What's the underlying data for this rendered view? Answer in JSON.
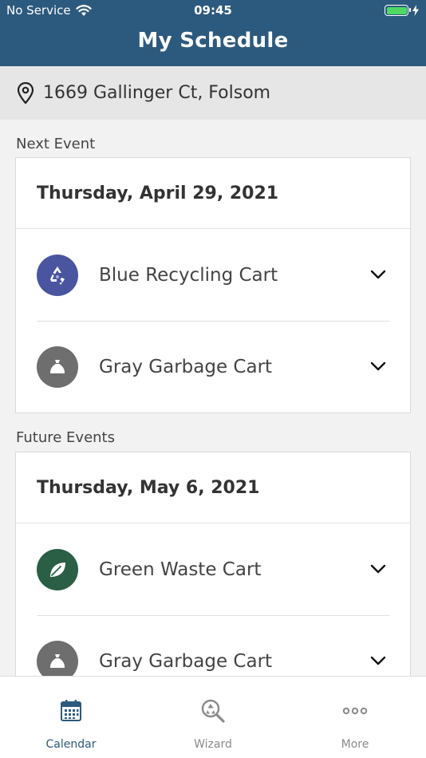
{
  "status": {
    "carrier": "No Service",
    "time": "09:45"
  },
  "header": {
    "title": "My Schedule"
  },
  "address": {
    "text": "1669 Gallinger Ct, Folsom"
  },
  "next_event": {
    "label": "Next Event",
    "date": "Thursday, April 29, 2021",
    "items": [
      {
        "label": "Blue Recycling Cart",
        "icon": "recycle-icon",
        "color": "#4a55a0"
      },
      {
        "label": "Gray Garbage Cart",
        "icon": "garbage-bag-icon",
        "color": "#6e6e6e"
      }
    ]
  },
  "future_events": {
    "label": "Future Events",
    "date": "Thursday, May 6, 2021",
    "items": [
      {
        "label": "Green Waste Cart",
        "icon": "leaf-icon",
        "color": "#2a5e45"
      },
      {
        "label": "Gray Garbage Cart",
        "icon": "garbage-bag-icon",
        "color": "#6e6e6e"
      }
    ]
  },
  "tabs": [
    {
      "label": "Calendar",
      "icon": "calendar-icon",
      "active": true
    },
    {
      "label": "Wizard",
      "icon": "wizard-search-icon",
      "active": false
    },
    {
      "label": "More",
      "icon": "more-dots-icon",
      "active": false
    }
  ],
  "colors": {
    "header": "#2c5a7e",
    "tab_active": "#2c5a7e",
    "tab_inactive": "#8a8a8a"
  }
}
